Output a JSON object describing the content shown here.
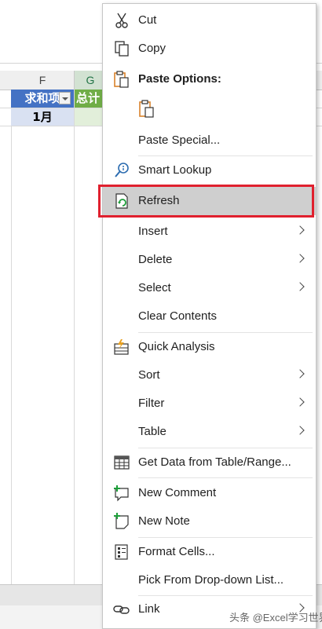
{
  "sheet": {
    "columns": [
      "F",
      "G"
    ],
    "cells": {
      "f1": "求和项",
      "g1": "总计",
      "f2": "1月"
    }
  },
  "menu": {
    "items": [
      {
        "label": "Cut",
        "icon": "scissors-icon"
      },
      {
        "label": "Copy",
        "icon": "copy-icon"
      },
      {
        "label": "Paste Options:",
        "icon": "paste-icon"
      },
      {
        "label": "Paste Special...",
        "icon": ""
      },
      {
        "label": "Smart Lookup",
        "icon": "search-icon"
      },
      {
        "label": "Refresh",
        "icon": "refresh-icon"
      },
      {
        "label": "Insert",
        "icon": ""
      },
      {
        "label": "Delete",
        "icon": ""
      },
      {
        "label": "Select",
        "icon": ""
      },
      {
        "label": "Clear Contents",
        "icon": ""
      },
      {
        "label": "Quick Analysis",
        "icon": "quick-analysis-icon"
      },
      {
        "label": "Sort",
        "icon": ""
      },
      {
        "label": "Filter",
        "icon": ""
      },
      {
        "label": "Table",
        "icon": ""
      },
      {
        "label": "Get Data from Table/Range...",
        "icon": "table-icon"
      },
      {
        "label": "New Comment",
        "icon": "new-comment-icon"
      },
      {
        "label": "New Note",
        "icon": "new-note-icon"
      },
      {
        "label": "Format Cells...",
        "icon": "format-cells-icon"
      },
      {
        "label": "Pick From Drop-down List...",
        "icon": ""
      },
      {
        "label": "Link",
        "icon": "link-icon"
      }
    ]
  },
  "watermark": "头条 @Excel学习世界",
  "colors": {
    "header_blue": "#4472c4",
    "header_green": "#70ad47",
    "highlight_border": "#e0202e",
    "paste_orange": "#d9822b"
  }
}
